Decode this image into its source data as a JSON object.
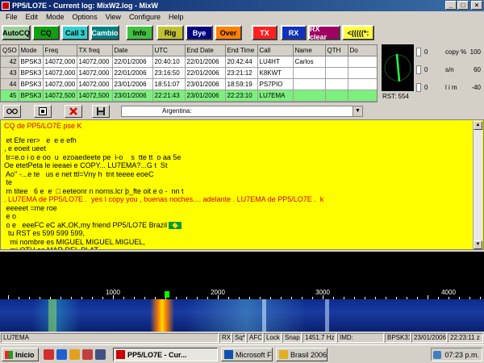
{
  "window": {
    "title": "PP5/LO7E - Current log: MixW2.log - MixW",
    "buttons": {
      "minimize": "_",
      "maximize": "□",
      "close": "×"
    }
  },
  "menu": [
    "File",
    "Edit",
    "Mode",
    "Options",
    "View",
    "Configure",
    "Help"
  ],
  "macros": [
    {
      "label": "AutoCQ",
      "bg": "#9bcf9b",
      "fg": "#000000"
    },
    {
      "label": "CQ",
      "bg": "#10a010",
      "fg": "#000000"
    },
    {
      "label": "Call 3",
      "bg": "#30d0d0",
      "fg": "#000000"
    },
    {
      "label": "Cambio",
      "bg": "#008080",
      "fg": "#ffffff"
    },
    {
      "label": "Info",
      "bg": "#40c040",
      "fg": "#000000"
    },
    {
      "label": "Rig",
      "bg": "#c0c030",
      "fg": "#000000"
    },
    {
      "label": "Bye",
      "bg": "#000080",
      "fg": "#ffffff"
    },
    {
      "label": "Over",
      "bg": "#ff8000",
      "fg": "#000000"
    },
    {
      "label": "TX",
      "bg": "#ff2020",
      "fg": "#ffffff"
    },
    {
      "label": "RX",
      "bg": "#1030c0",
      "fg": "#ffffff"
    },
    {
      "label": "RX clear",
      "bg": "#a00060",
      "fg": "#ffffff"
    },
    {
      "label": "<(((((*:",
      "bg": "#ffff40",
      "fg": "#000000"
    }
  ],
  "qso_table": {
    "headers": [
      "QSO",
      "Mode",
      "Freq",
      "TX freq",
      "Date",
      "UTC",
      "End Date",
      "End Time",
      "Call",
      "Name",
      "QTH",
      "Do"
    ],
    "rows": [
      {
        "qso": "42",
        "mode": "BPSK3",
        "freq": "14072,000",
        "txfreq": "14072,000",
        "date": "22/01/2006",
        "utc": "20:40:10",
        "enddate": "22/01/2006",
        "endtime": "20:42:44",
        "call": "LU4HT",
        "name": "Carlos",
        "qth": "",
        "do": ""
      },
      {
        "qso": "43",
        "mode": "BPSK3",
        "freq": "14072,000",
        "txfreq": "14072,000",
        "date": "22/01/2006",
        "utc": "23:16:50",
        "enddate": "22/01/2006",
        "endtime": "23:21:12",
        "call": "K8KWT",
        "name": "",
        "qth": "",
        "do": ""
      },
      {
        "qso": "44",
        "mode": "BPSK3",
        "freq": "14072,000",
        "txfreq": "14072,000",
        "date": "23/01/2006",
        "utc": "18:51:07",
        "enddate": "23/01/2006",
        "endtime": "18:59:19",
        "call": "PS7PIO",
        "name": "",
        "qth": "",
        "do": ""
      },
      {
        "qso": "45",
        "mode": "BPSK3",
        "freq": "14072,500",
        "txfreq": "14072,500",
        "date": "23/01/2006",
        "utc": "22:21:43",
        "enddate": "23/01/2006",
        "endtime": "22:23:10",
        "call": "LU7EMA",
        "name": "",
        "qth": "",
        "do": ""
      }
    ],
    "selected_row": 3
  },
  "meter": {
    "rst": "RST: 554",
    "rows": [
      {
        "lo": "0",
        "label": "copy %",
        "hi": "100"
      },
      {
        "lo": "0",
        "label": "s/n",
        "hi": "60"
      },
      {
        "lo": "0",
        "label": "l i m",
        "hi": "-40"
      }
    ]
  },
  "toolbar": {
    "combo_value": "Argentina:"
  },
  "rx_lines": [
    {
      "text": "CQ de PP5/LO7E pse K",
      "red": true
    },
    {
      "text": "",
      "blank": true
    },
    {
      "text": " et Efe rer>   e  e e efh",
      "red": false
    },
    {
      "text": ", e eoeit ueet",
      "red": false
    },
    {
      "text": " tr=e.o i o e oo  u  ezoaedeete pe  i-o    s  tte tt  o aa 5e",
      "red": false
    },
    {
      "text": "Oe etetPeta le ieeaei e COPY... LU7EMA?...G t  St",
      "red": false
    },
    {
      "text": " Ao\" -...e te   us e net ttl=Vny h  tnt teeee eoeC",
      "red": false
    },
    {
      "text": " te",
      "red": false
    },
    {
      "text": " m titee   6 e  e  □ eeteonr n norns.lcr þ_fte oit e o -  nn t",
      "red": false
    },
    {
      "text": ". LU7EMA de PP5/LO7E .  yes I copy you , buenas noches.... adelante . LU7EMA de PP5/LO7E .  k",
      "red": true
    },
    {
      "text": " eeeeet =me roe",
      "red": false
    },
    {
      "text": " e o",
      "red": false
    },
    {
      "text": " o e   eeeFC eC aK,OK,my friend PP5/LO7E Brazil",
      "red": false,
      "flag": true
    },
    {
      "text": "  tu RST es 599 599 599,",
      "red": false
    },
    {
      "text": "   mi nombre es MIGUEL MIGUEL MIGUEL,",
      "red": false
    },
    {
      "text": "   mi QTH es MAR DEL PLAT",
      "red": false
    }
  ],
  "spectrum": {
    "ticks": [
      "1000",
      "2000",
      "3000",
      "4000"
    ]
  },
  "status": {
    "call": "LU7EMA",
    "rx": "RX",
    "sq": "Sq*",
    "afc": "AFC",
    "lock": "Lock",
    "snap": "Snap",
    "freq": "1451.7 Hz",
    "imd": "IMD:",
    "mode": "BPSK31",
    "date": "23/01/2006",
    "time": "22:23:11 z"
  },
  "taskbar": {
    "start": "Inicio",
    "tasks": [
      "PP5/LO7E - Cur...",
      "Microsoft FrontPage...",
      "Brasil 2006"
    ],
    "clock": "07:23 p.m."
  },
  "colors": {
    "rx_bg": "#ffff00",
    "rx_red": "#d00000",
    "selected_row": "#7cf07c"
  }
}
